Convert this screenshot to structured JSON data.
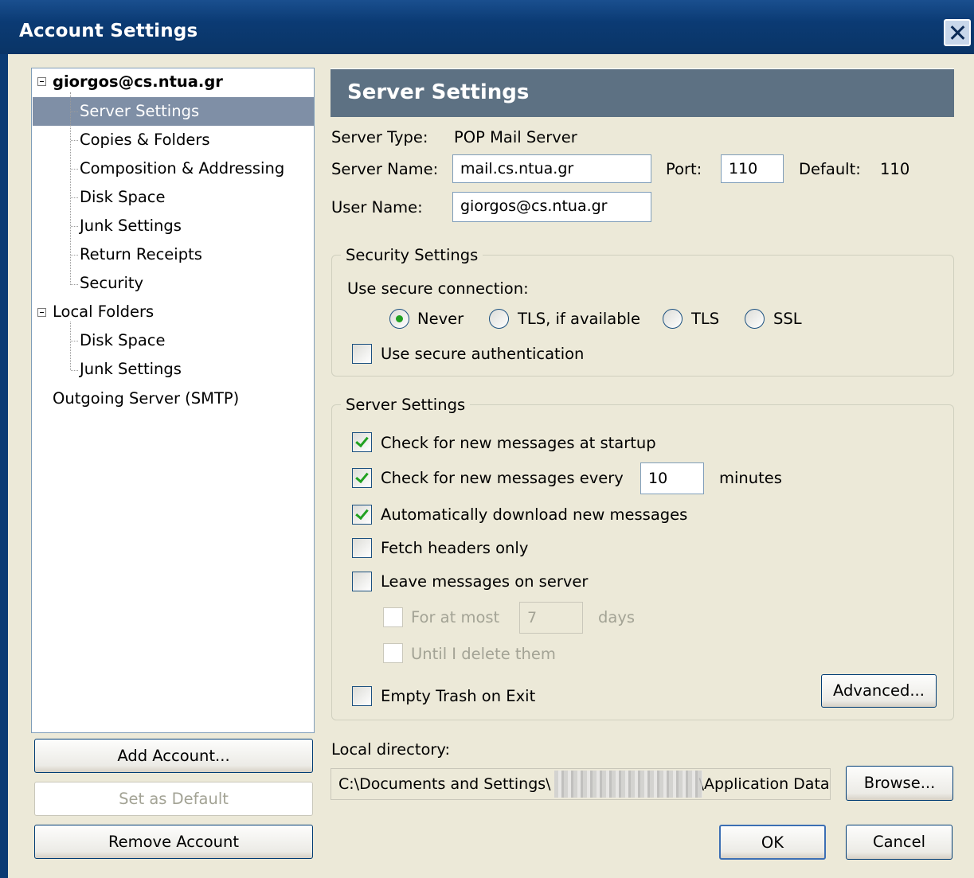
{
  "window": {
    "title": "Account Settings"
  },
  "tree": {
    "account": "giorgos@cs.ntua.gr",
    "account_items": [
      "Server Settings",
      "Copies & Folders",
      "Composition & Addressing",
      "Disk Space",
      "Junk Settings",
      "Return Receipts",
      "Security"
    ],
    "local_folders": "Local Folders",
    "local_items": [
      "Disk Space",
      "Junk Settings"
    ],
    "outgoing": "Outgoing Server (SMTP)"
  },
  "left_buttons": {
    "add_account": "Add Account...",
    "set_default": "Set as Default",
    "remove_account": "Remove Account"
  },
  "panel": {
    "header": "Server Settings",
    "server_type_label": "Server Type:",
    "server_type_value": "POP Mail Server",
    "server_name_label": "Server Name:",
    "server_name_value": "mail.cs.ntua.gr",
    "port_label": "Port:",
    "port_value": "110",
    "default_label": "Default:",
    "default_value": "110",
    "user_name_label": "User Name:",
    "user_name_value": "giorgos@cs.ntua.gr"
  },
  "security": {
    "group_title": "Security Settings",
    "use_secure_label": "Use secure connection:",
    "options": [
      "Never",
      "TLS, if available",
      "TLS",
      "SSL"
    ],
    "selected": "Never",
    "secure_auth_label": "Use secure authentication",
    "secure_auth_checked": false
  },
  "server": {
    "group_title": "Server Settings",
    "check_startup": "Check for new messages at startup",
    "check_every": "Check for new messages every",
    "check_every_value": "10",
    "minutes": "minutes",
    "auto_download": "Automatically download new messages",
    "fetch_headers": "Fetch headers only",
    "leave_on_server": "Leave messages on server",
    "for_at_most": "For at most",
    "for_at_most_value": "7",
    "days": "days",
    "until_delete": "Until I delete them",
    "empty_trash": "Empty Trash on Exit",
    "advanced": "Advanced..."
  },
  "local_dir": {
    "label": "Local directory:",
    "path_start": "C:\\Documents and Settings\\",
    "path_end": "\\Application Data",
    "browse": "Browse..."
  },
  "dialog_buttons": {
    "ok": "OK",
    "cancel": "Cancel"
  },
  "colors": {
    "titlebar": "#0b3b74",
    "header_band": "#5d7183",
    "selected_row": "#7f8fa6",
    "dialog_bg": "#ece9d8",
    "check_mark": "#21a121"
  }
}
